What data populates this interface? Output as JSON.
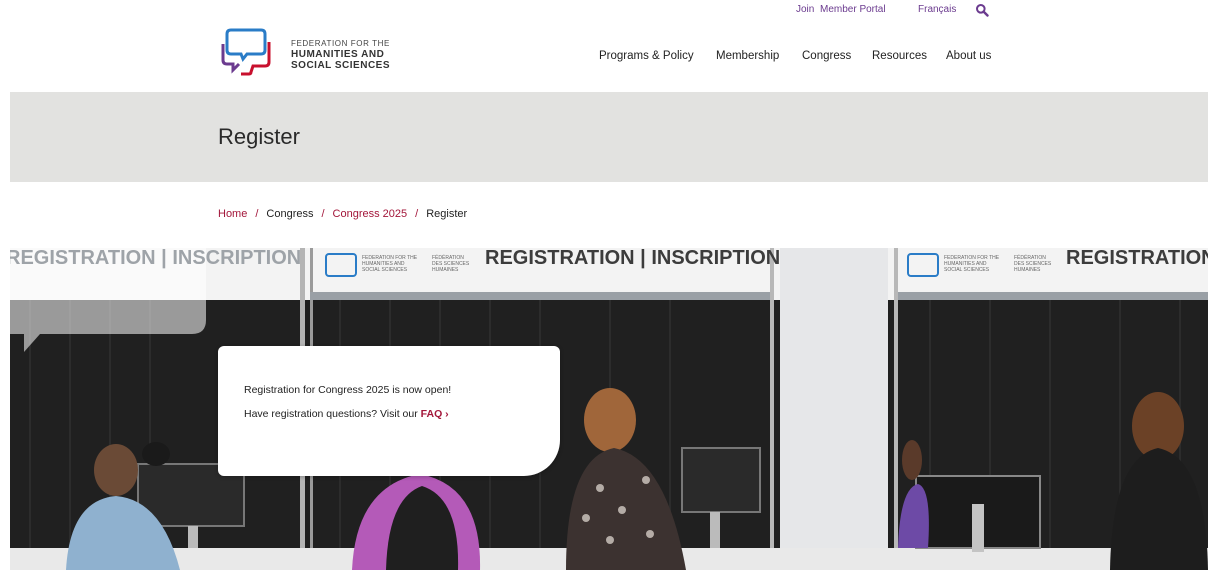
{
  "utility_nav": {
    "join": "Join",
    "member_portal": "Member Portal",
    "language": "Français"
  },
  "logo": {
    "line1": "FEDERATION FOR THE",
    "line2": "HUMANITIES AND",
    "line3": "SOCIAL SCIENCES"
  },
  "main_nav": {
    "items": [
      {
        "label": "Programs & Policy"
      },
      {
        "label": "Membership"
      },
      {
        "label": "Congress"
      },
      {
        "label": "Resources"
      },
      {
        "label": "About us"
      }
    ]
  },
  "page": {
    "title": "Register"
  },
  "breadcrumb": {
    "items": [
      "Home",
      "Congress",
      "Congress 2025"
    ],
    "separator": "/",
    "current": "Register"
  },
  "hero": {
    "sign_left": "REGISTRATION | INSCRIPTION",
    "sign_middle": "REGISTRATION | INSCRIPTION",
    "sign_right": "REGISTRATION |",
    "sign_logo_en_1": "FEDERATION FOR THE",
    "sign_logo_en_2": "HUMANITIES AND",
    "sign_logo_en_3": "SOCIAL SCIENCES",
    "sign_logo_fr_1": "FÉDÉRATION",
    "sign_logo_fr_2": "DES SCIENCES",
    "sign_logo_fr_3": "HUMAINES",
    "card_line1": "Registration for Congress 2025 is now open!",
    "card_line2_prefix": "Have registration questions? Visit our ",
    "faq_label": "FAQ",
    "faq_arrow": "›"
  },
  "colors": {
    "accent_red": "#a3163a",
    "accent_purple": "#6b3b8f",
    "logo_blue": "#2a7cc7",
    "banner_bg": "#e2e2e0"
  },
  "icons": [
    "search-icon",
    "logo-speech-bubbles-icon",
    "chevron-right-icon"
  ]
}
